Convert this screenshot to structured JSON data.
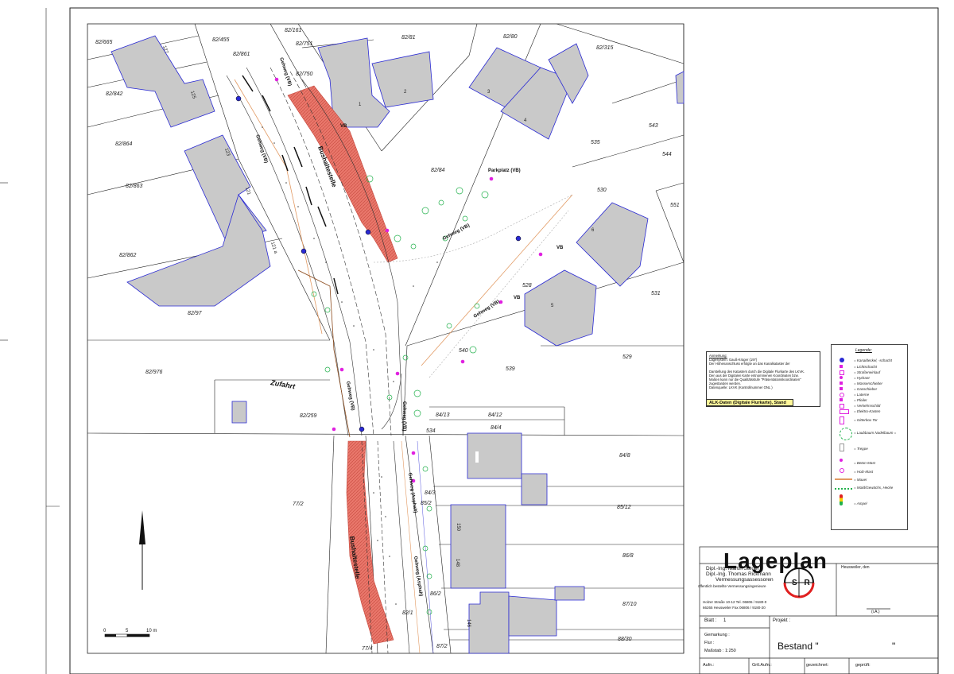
{
  "parcels": [
    "82/161",
    "82/455",
    "82/751",
    "82/81",
    "82/80",
    "82/315",
    "82/665",
    "82/861",
    "82/750",
    "82/842",
    "82/864",
    "82/863",
    "82/862",
    "82/97",
    "82/976",
    "82/84",
    "82/259",
    "84/13",
    "84/12",
    "84/4",
    "84/8",
    "84/3",
    "85/2",
    "85/12",
    "86/8",
    "86/2",
    "87/10",
    "87/2",
    "88/30",
    "82/1",
    "77/2",
    "77/4",
    "535",
    "543",
    "544",
    "530",
    "551",
    "528",
    "531",
    "529",
    "539",
    "540",
    "534"
  ],
  "house_numbers": [
    "127",
    "125",
    "123",
    "121",
    "121 a",
    "1",
    "2",
    "3",
    "4",
    "6",
    "5",
    "150",
    "148",
    "146"
  ],
  "street_labels": {
    "gehweg_vb_1": "Gehweg (VB)",
    "gehweg_vb_2": "Gehweg (VB)",
    "gehweg_vb_3": "Gehweg (VB)",
    "gehweg_vb_4": "Gehweg (VB)",
    "gehweg_vb_5": "Gehweg (VB)",
    "gehweg_vb_6": "Gehweg (VB)",
    "gehweg_asphalt_1": "Gehweg (Asphalt)",
    "gehweg_asphalt_2": "Gehweg (Asphalt)",
    "bushaltestelle_1": "Bushaltestelle",
    "bushaltestelle_2": "Bushaltestelle",
    "parkplatz": "Parkplatz\n(VB)",
    "zufahrt": "Zufahrt",
    "vb_1": "VB",
    "vb_2": "VB",
    "vb_3": "VB"
  },
  "note": {
    "heading": "Anmerkung:",
    "lines": [
      "Lagesystem: Gauß-Krüger (197)",
      "Der Höhenanschluss erfolgte an das Kanalkataster der",
      "",
      "Darstellung des Katasters durch die Digitale Flurkarte des LKVK.",
      "Den aus der Digitalen Karte entnommenen Koordinaten bzw.",
      "Maßen kann nur die Qualitätsstufe \"Präsentationskoordinaten\"",
      "zugestanden werden.",
      "Datenquelle: LKVK (Kontrollnummer ONL                    )"
    ],
    "alk": "ALK-Daten (Digitale Flurkarte), Stand"
  },
  "legend": {
    "title": "Legende:",
    "items": [
      "= Kanaldeckel, -schacht",
      "= Lichtschacht",
      "= Straßeneinlauf",
      "= Hydrant",
      "= Wasserschieber",
      "= Gasschieber",
      "= Laterne",
      "= Pfeiler",
      "= Verkehrsschild",
      "= Elektro-Kasten",
      "= Gitterbox Tor",
      "= Laubbaum  Nadelbaum =",
      "= Treppe",
      "= Beton-Mast",
      "= Holz-Mast",
      "= Mauer",
      "= Wald/Gewächs, Hecke",
      "= Ampel"
    ]
  },
  "titleblock": {
    "title": "Lageplan",
    "firm_line1": "Dipl.-Ing. Martin Steuer",
    "firm_line2": "Dipl.-Ing. Thomas Rickmann",
    "firm_line3": "Vermessungsassessoren",
    "firm_line4": "öffentlich bestellte Vermessungsingenieure",
    "address_line1": "Holzer Straße 10-12     Tel. 06806 / 9180-0",
    "address_line2": "66265 Heusweiler       Fax 06806 / 9180-20",
    "place": "Heusweiler, den",
    "signature": "(i.A.)",
    "blatt_label": "Blatt :",
    "blatt_value": "1",
    "projekt_label": "Projekt :",
    "gemarkung_label": "Gemarkung :",
    "flur_label": "Flur :",
    "massstab_label": "Maßstab : 1:250",
    "bestand": "Bestand \"",
    "bestand_end": "\"",
    "aufn_label": "Aufn.:",
    "ortl_label": "Grtl.Aufn.:",
    "gezeichnet_label": "gezeichnet:",
    "geprueft_label": "geprüft:",
    "logo": "S R"
  },
  "scale": {
    "labels": [
      "0",
      "5",
      "10 m"
    ]
  },
  "colors": {
    "building_fill": "#c9c9c9",
    "building_stroke": "#2a2ad4",
    "red_area": "#e9776b",
    "tree_green": "#22b14c",
    "marker_magenta": "#e020e0",
    "yellow_note": "#fff799"
  }
}
